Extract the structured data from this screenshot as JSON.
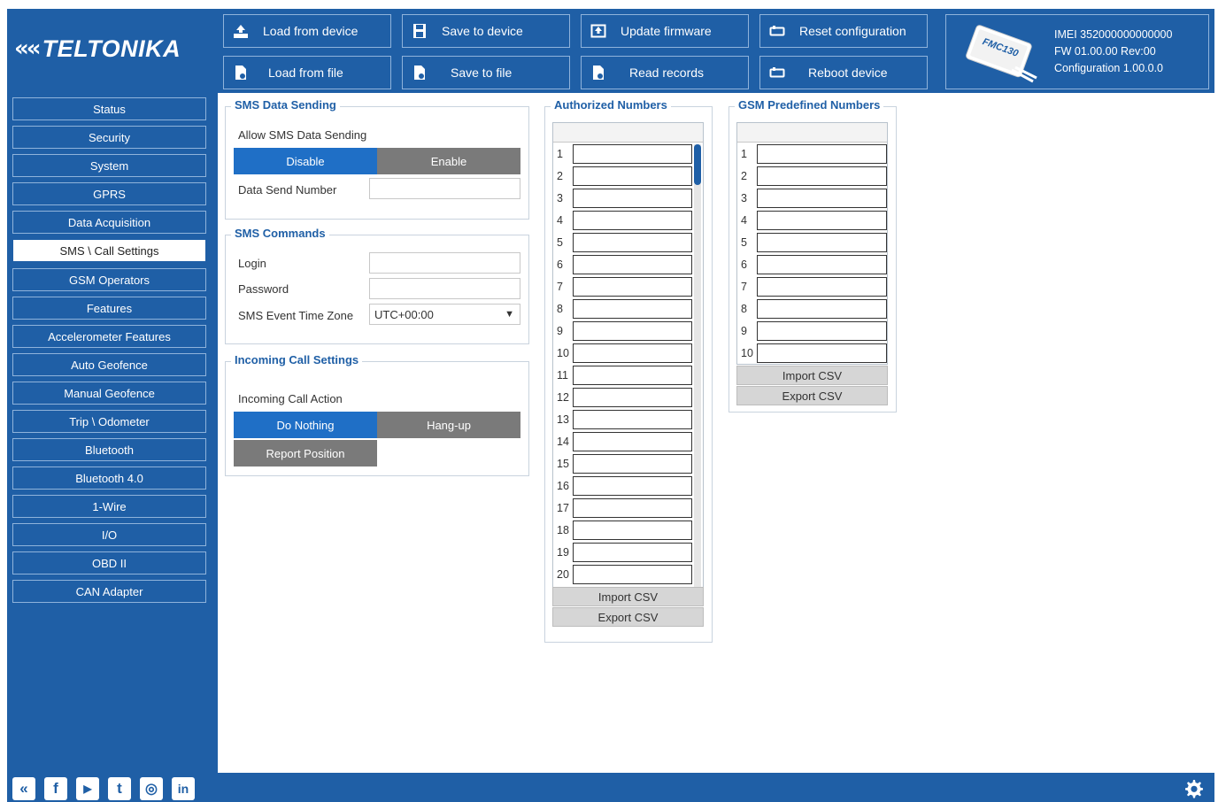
{
  "brand": {
    "logo_mark": "««",
    "logo_text": "TELTONIKA"
  },
  "toolbar": {
    "load_from_device": "Load from device",
    "save_to_device": "Save to device",
    "update_firmware": "Update firmware",
    "reset_configuration": "Reset configuration",
    "load_from_file": "Load from file",
    "save_to_file": "Save to file",
    "read_records": "Read records",
    "reboot_device": "Reboot device"
  },
  "device": {
    "model_label": "FMC130",
    "imei": "IMEI 352000000000000",
    "fw": "FW 01.00.00 Rev:00",
    "config": "Configuration 1.00.0.0"
  },
  "sidebar": {
    "active": "SMS \\ Call Settings",
    "items": [
      "Status",
      "Security",
      "System",
      "GPRS",
      "Data Acquisition",
      "SMS \\ Call Settings",
      "GSM Operators",
      "Features",
      "Accelerometer Features",
      "Auto Geofence",
      "Manual Geofence",
      "Trip \\ Odometer",
      "Bluetooth",
      "Bluetooth 4.0",
      "1-Wire",
      "I/O",
      "OBD II",
      "CAN Adapter"
    ]
  },
  "sms_data_sending": {
    "title": "SMS Data Sending",
    "allow_label": "Allow SMS Data Sending",
    "disable": "Disable",
    "enable": "Enable",
    "selected": "Disable",
    "send_number_label": "Data Send Number",
    "send_number_value": ""
  },
  "sms_commands": {
    "title": "SMS Commands",
    "login_label": "Login",
    "login_value": "",
    "password_label": "Password",
    "password_value": "",
    "timezone_label": "SMS Event Time Zone",
    "timezone_value": "UTC+00:00"
  },
  "incoming_call": {
    "title": "Incoming Call Settings",
    "action_label": "Incoming Call Action",
    "do_nothing": "Do Nothing",
    "hang_up": "Hang-up",
    "report_position": "Report Position",
    "selected": "Do Nothing"
  },
  "authorized_numbers": {
    "title": "Authorized Numbers",
    "rows": [
      "1",
      "2",
      "3",
      "4",
      "5",
      "6",
      "7",
      "8",
      "9",
      "10",
      "11",
      "12",
      "13",
      "14",
      "15",
      "16",
      "17",
      "18",
      "19",
      "20"
    ],
    "import_csv": "Import CSV",
    "export_csv": "Export CSV"
  },
  "gsm_predefined": {
    "title": "GSM Predefined Numbers",
    "rows": [
      "1",
      "2",
      "3",
      "4",
      "5",
      "6",
      "7",
      "8",
      "9",
      "10"
    ],
    "import_csv": "Import CSV",
    "export_csv": "Export CSV"
  },
  "social": [
    "teltonika-icon",
    "facebook-icon",
    "youtube-icon",
    "twitter-icon",
    "instagram-icon",
    "linkedin-icon"
  ],
  "social_glyphs": {
    "teltonika": "«",
    "facebook": "f",
    "youtube": "▶",
    "twitter": "t",
    "instagram": "◎",
    "linkedin": "in"
  },
  "colors": {
    "primary": "#1f5fa6",
    "selected": "#1f6fc6",
    "unselected": "#7a7a7a"
  }
}
